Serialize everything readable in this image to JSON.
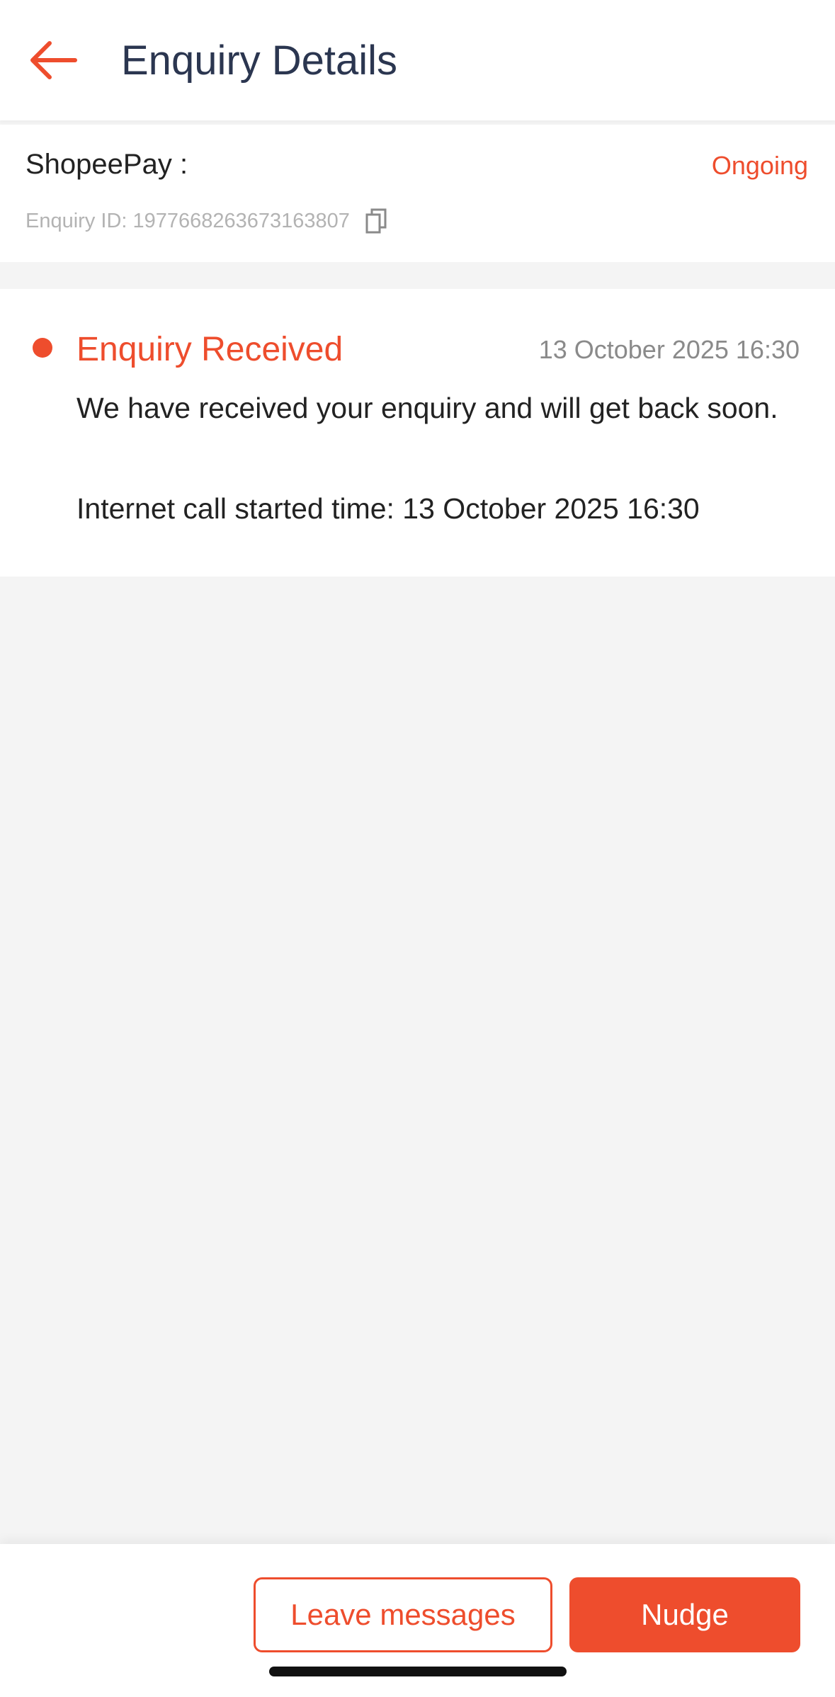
{
  "header": {
    "title": "Enquiry Details",
    "back_icon": "back-arrow-icon"
  },
  "enquiry": {
    "service": "ShopeePay :",
    "status": "Ongoing",
    "id_text": "Enquiry ID: 1977668263673163807",
    "copy_icon": "copy-icon"
  },
  "timeline": {
    "items": [
      {
        "title": "Enquiry Received",
        "time": "13 October 2025 16:30",
        "description": "We have received your enquiry and will get back soon.",
        "call_started": "Internet call started time: 13 October 2025 16:30"
      }
    ]
  },
  "actions": {
    "leave_messages": "Leave messages",
    "nudge": "Nudge"
  },
  "colors": {
    "accent": "#ee4d2d",
    "title_text": "#2b3650",
    "muted_text": "#8a8a8a",
    "page_background": "#f4f4f4"
  }
}
